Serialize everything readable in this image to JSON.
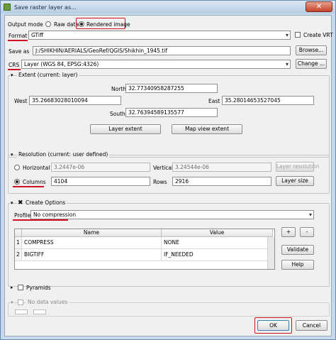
{
  "window": {
    "title": "Save raster layer as..."
  },
  "output_mode": {
    "label": "Output mode",
    "option_raw": "Raw data",
    "option_rendered": "Rendered image",
    "selected": "Rendered image"
  },
  "format": {
    "label": "Format",
    "value": "GTiff",
    "create_vrt_label": "Create VRT"
  },
  "save_as": {
    "label": "Save as",
    "value": "J:/SHIKHIN/AERIALS/GeoRef/QGIS/Shikhin_1945.tif",
    "browse_label": "Browse..."
  },
  "crs": {
    "label": "CRS",
    "value": "Layer (WGS 84, EPSG:4326)",
    "change_label": "Change ..."
  },
  "extent": {
    "title": "Extent (current: layer)",
    "north_label": "North",
    "north": "32.77340958287255",
    "west_label": "West",
    "west": "35.26683028010094",
    "east_label": "East",
    "east": "35.28014653527045",
    "south_label": "South",
    "south": "32.76394589135577",
    "layer_extent_label": "Layer extent",
    "map_view_extent_label": "Map view extent"
  },
  "resolution": {
    "title": "Resolution (current: user defined)",
    "horizontal_label": "Horizontal",
    "horizontal": "3.2447e-06",
    "vertical_label": "Vertical",
    "vertical": "3.24544e-06",
    "layer_resolution_label": "Layer resolution",
    "columns_label": "Columns",
    "columns": "4104",
    "rows_label": "Rows",
    "rows": "2916",
    "layer_size_label": "Layer size",
    "selected": "Columns"
  },
  "create_options": {
    "title": "Create Options",
    "profile_label": "Profile",
    "profile": "No compression",
    "columns": [
      "Name",
      "Value"
    ],
    "rows": [
      {
        "index": "1",
        "name": "COMPRESS",
        "value": "NONE"
      },
      {
        "index": "2",
        "name": "BIGTIFF",
        "value": "IF_NEEDED"
      }
    ],
    "add_label": "+",
    "remove_label": "-",
    "validate_label": "Validate",
    "help_label": "Help"
  },
  "pyramids": {
    "title": "Pyramids"
  },
  "no_data": {
    "title": "No data values"
  },
  "buttons": {
    "ok_label": "OK",
    "cancel_label": "Cancel"
  }
}
